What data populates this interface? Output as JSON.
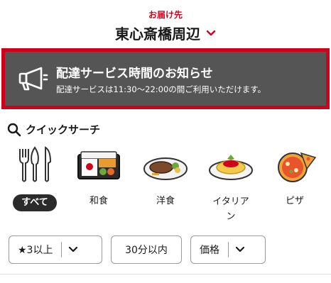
{
  "header": {
    "deliver_label": "お届け先",
    "location": "東心斎橋周辺"
  },
  "notice": {
    "title": "配達サービス時間のお知らせ",
    "body": "配達サービスは11:30〜22:00の間ご利用いただけます。"
  },
  "quick_search": {
    "heading": "クイックサーチ",
    "categories": [
      {
        "label": "すべて",
        "icon": "cutlery-icon",
        "selected": true
      },
      {
        "label": "和食",
        "icon": "bento-icon",
        "selected": false
      },
      {
        "label": "洋食",
        "icon": "steak-plate-icon",
        "selected": false
      },
      {
        "label": "イタリアン",
        "icon": "pasta-icon",
        "selected": false
      },
      {
        "label": "ピザ",
        "icon": "pizza-icon",
        "selected": false
      }
    ]
  },
  "filters": {
    "rating": "★3以上",
    "time": "30分以内",
    "price": "価格"
  },
  "colors": {
    "accent": "#d0021b",
    "notice_bg": "#555555",
    "selected_pill": "#2b2b2b"
  }
}
